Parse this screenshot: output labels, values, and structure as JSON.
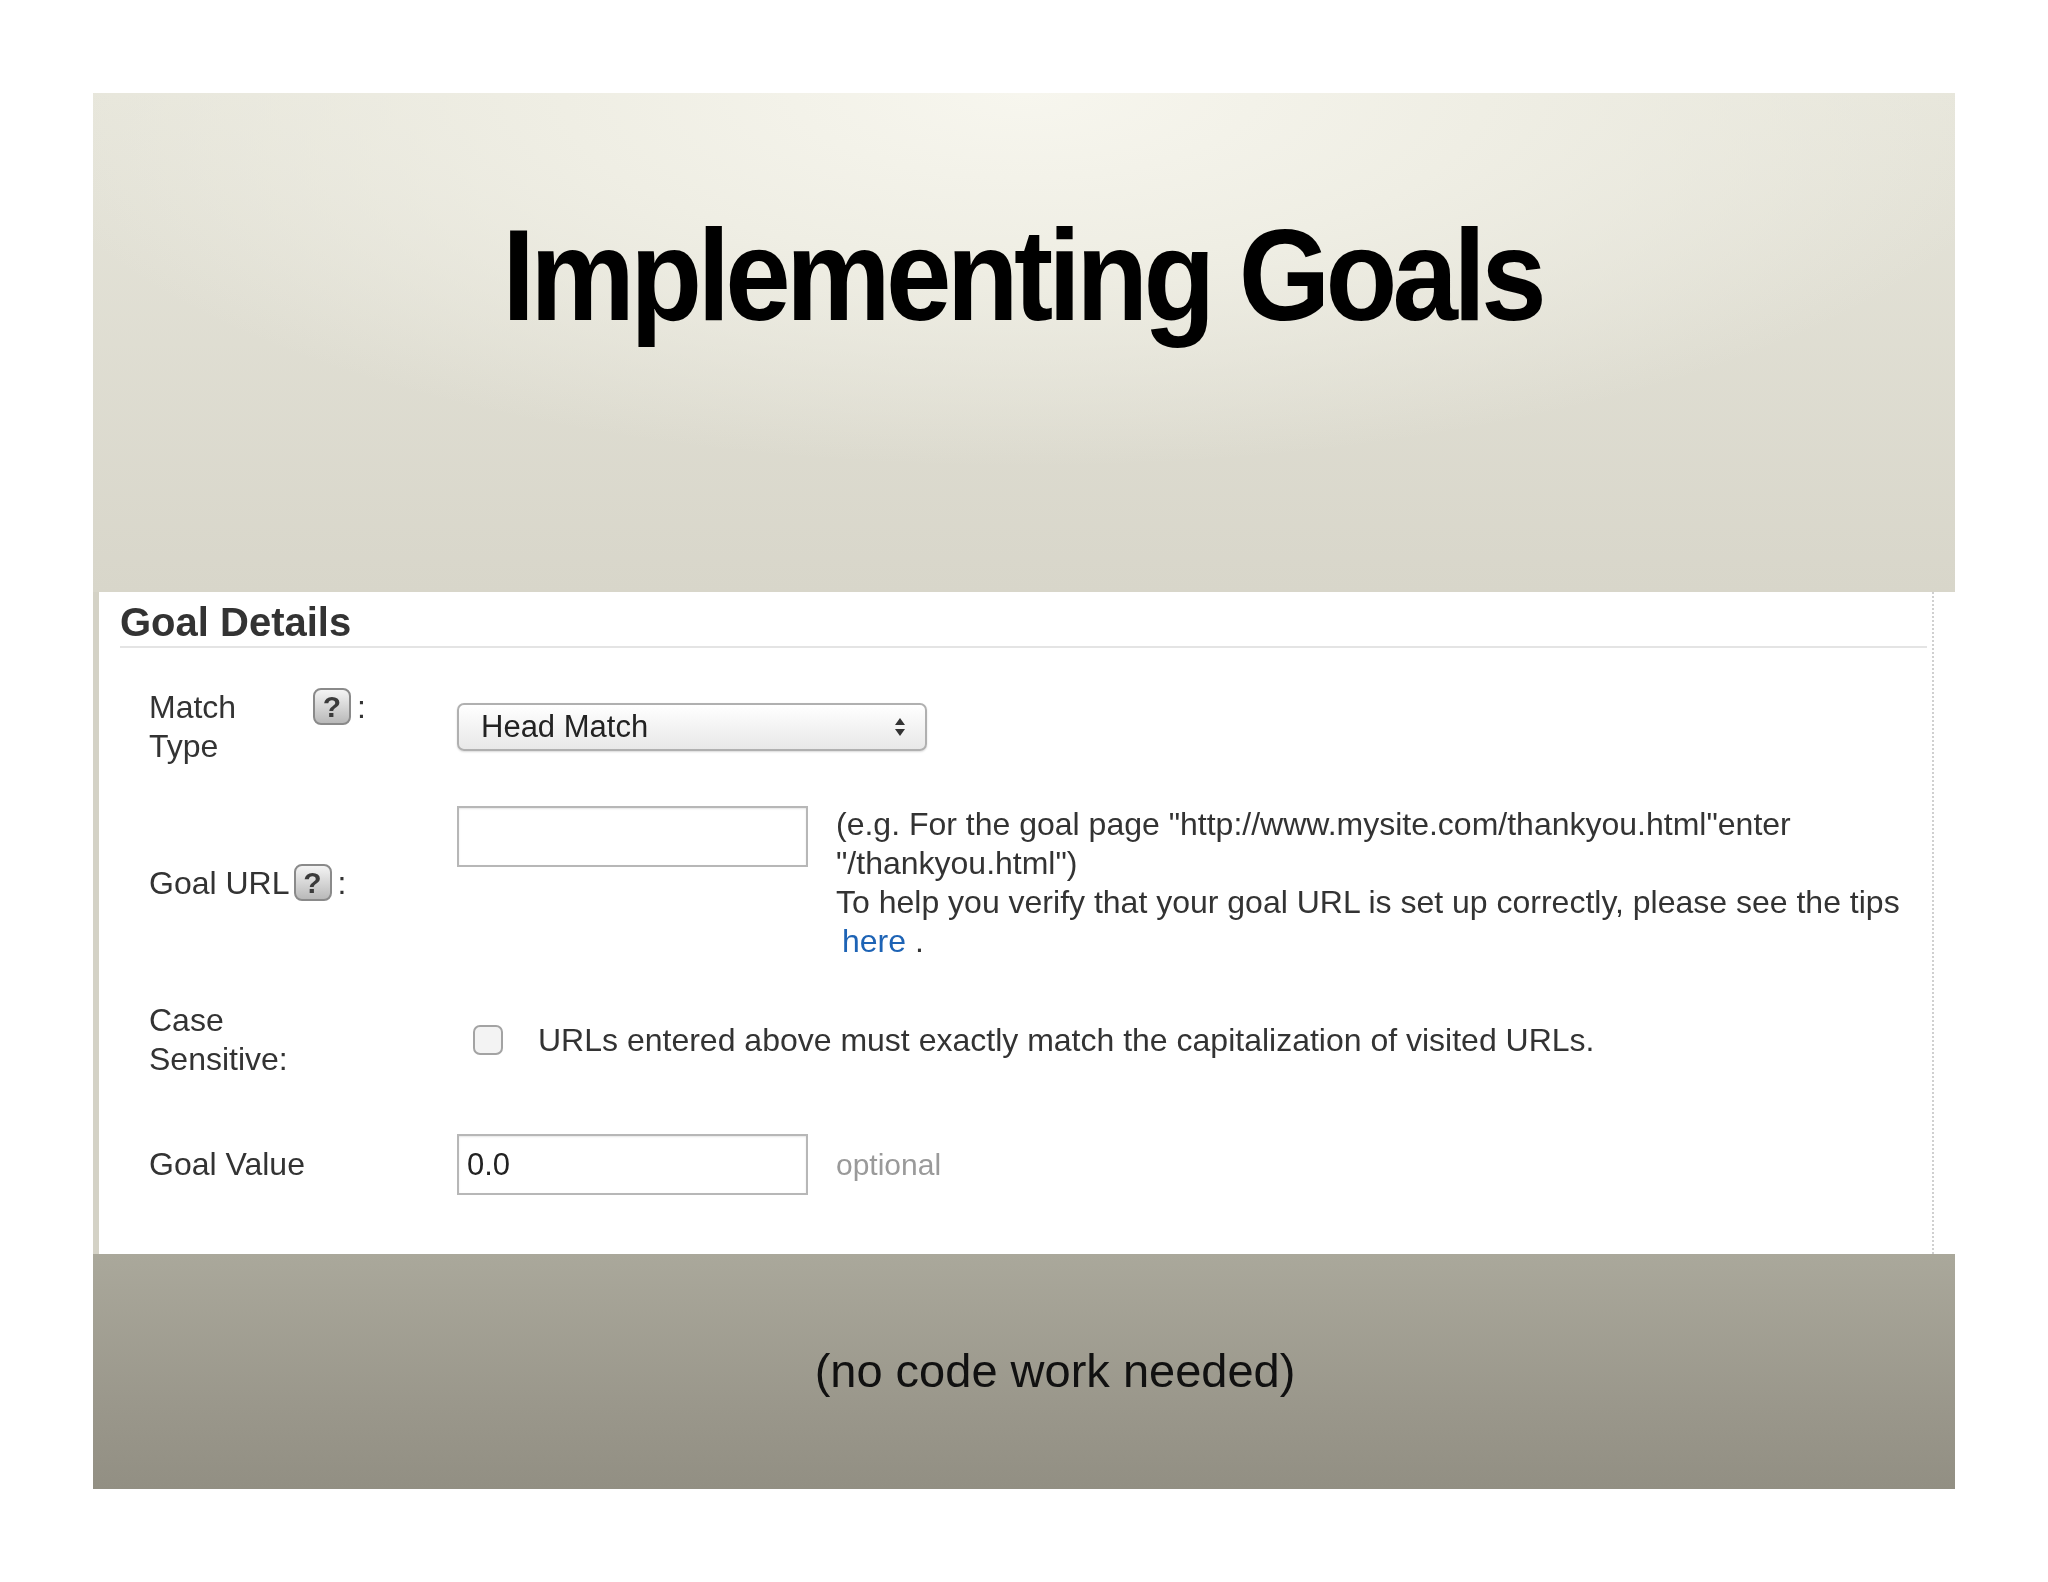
{
  "slide": {
    "title": "Implementing Goals",
    "note": "(no code work needed)"
  },
  "panel": {
    "heading": "Goal Details",
    "rows": [
      {
        "kind": "select",
        "label": "Match Type",
        "help": "?",
        "suffix": ":",
        "value": "Head Match"
      },
      {
        "kind": "text",
        "label": "Goal URL",
        "help": "?",
        "suffix": ":",
        "hints": [
          {
            "text": "(e.g. For the goal page \"http://www.mysite.com/thankyou.html\"enter \"/thankyou.html\")"
          },
          {
            "text": "To help you verify that your goal URL is set up correctly, please see the tips",
            "link": "here",
            "end": "."
          }
        ]
      },
      {
        "kind": "checkbox",
        "label": "Case Sensitive:",
        "checked": false,
        "text": "URLs entered above must exactly match the capitalization of visited URLs."
      },
      {
        "kind": "text",
        "label": "Goal Value",
        "value": "0.0",
        "note": "optional"
      }
    ]
  }
}
